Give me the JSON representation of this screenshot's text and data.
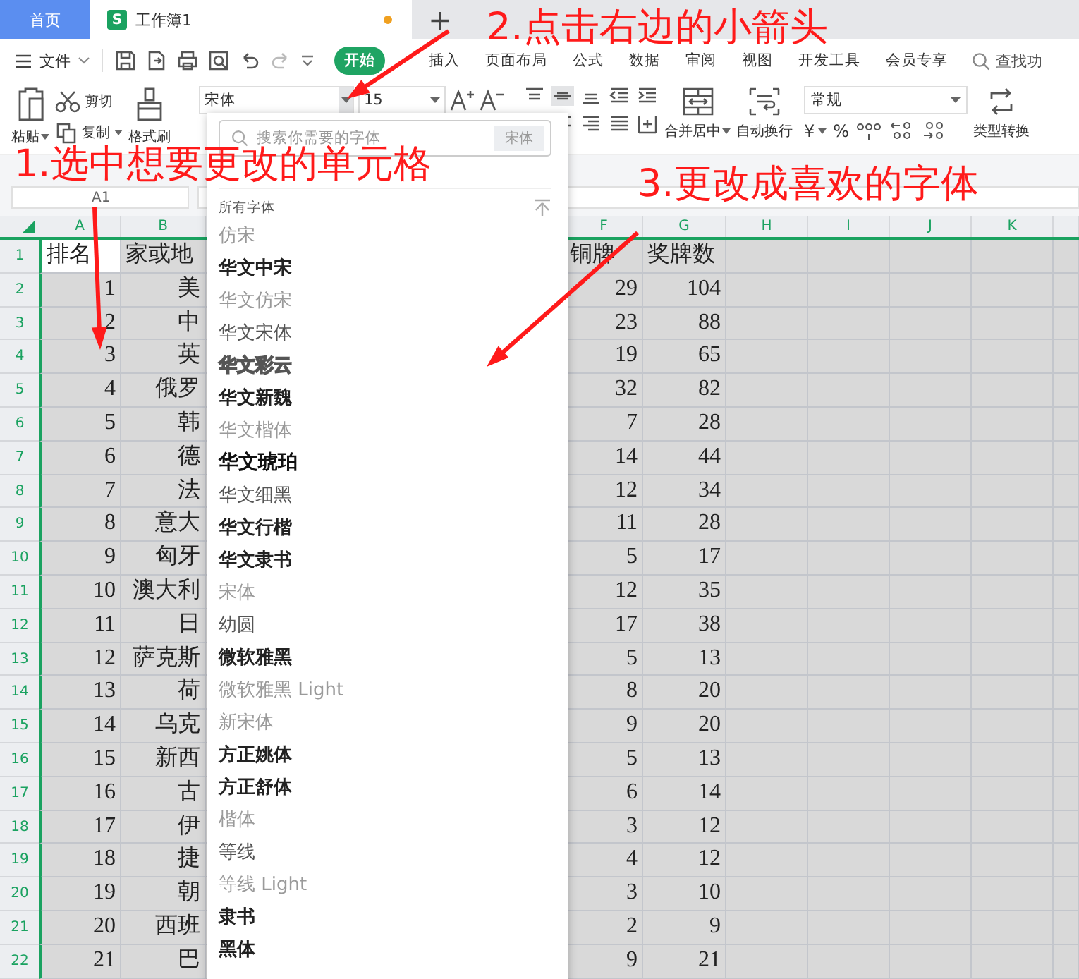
{
  "window_tabs": [
    {
      "kind": "home",
      "label": "首页",
      "selected": false
    },
    {
      "kind": "document",
      "label": "工作簿1",
      "badge": "S",
      "unsaved": true,
      "selected": true
    }
  ],
  "new_tab": "+",
  "menu": {
    "file": "文件",
    "tabs": [
      {
        "label": "开始",
        "selected": true
      },
      {
        "label": "插入",
        "selected": false
      },
      {
        "label": "页面布局",
        "selected": false
      },
      {
        "label": "公式",
        "selected": false
      },
      {
        "label": "数据",
        "selected": false
      },
      {
        "label": "审阅",
        "selected": false
      },
      {
        "label": "视图",
        "selected": false
      },
      {
        "label": "开发工具",
        "selected": false
      },
      {
        "label": "会员专享",
        "selected": false
      }
    ],
    "search": "查找功"
  },
  "ribbon": {
    "paste": "粘贴",
    "cut": "剪切",
    "copy": "复制",
    "format_painter": "格式刷",
    "font": "宋体",
    "size": "15",
    "merge": "合并居中",
    "wrap": "自动换行",
    "number_format": "常规",
    "currency": "¥",
    "percent": "%",
    "convert": "类型转换"
  },
  "name_box": "A1",
  "font_dropdown": {
    "search_placeholder": "搜索你需要的字体",
    "current": "宋体",
    "section": "所有字体",
    "fonts": [
      {
        "name": "仿宋",
        "kind": "light"
      },
      {
        "name": "华文中宋",
        "kind": "bold"
      },
      {
        "name": "华文仿宋",
        "kind": "light"
      },
      {
        "name": "华文宋体",
        "kind": "regular"
      },
      {
        "name": "华文彩云",
        "kind": "outline"
      },
      {
        "name": "华文新魏",
        "kind": "bold"
      },
      {
        "name": "华文楷体",
        "kind": "light"
      },
      {
        "name": "华文琥珀",
        "kind": "heavy"
      },
      {
        "name": "华文细黑",
        "kind": "regular"
      },
      {
        "name": "华文行楷",
        "kind": "bold"
      },
      {
        "name": "华文隶书",
        "kind": "bold"
      },
      {
        "name": "宋体",
        "kind": "light"
      },
      {
        "name": "幼圆",
        "kind": "regular"
      },
      {
        "name": "微软雅黑",
        "kind": "bold"
      },
      {
        "name": "微软雅黑 Light",
        "kind": "light"
      },
      {
        "name": "新宋体",
        "kind": "light"
      },
      {
        "name": "方正姚体",
        "kind": "bold"
      },
      {
        "name": "方正舒体",
        "kind": "bold"
      },
      {
        "name": "楷体",
        "kind": "light"
      },
      {
        "name": "等线",
        "kind": "regular"
      },
      {
        "name": "等线 Light",
        "kind": "light"
      },
      {
        "name": "隶书",
        "kind": "bold"
      },
      {
        "name": "黑体",
        "kind": "bold"
      }
    ]
  },
  "sheet": {
    "all_selected": true,
    "columns": [
      "A",
      "B",
      "F",
      "G",
      "H",
      "I",
      "J",
      "K"
    ],
    "rows": [
      {
        "number": "1",
        "active": true,
        "cells": [
          "排名",
          "家或地",
          "铜牌",
          "奖牌数"
        ]
      },
      {
        "number": "2",
        "active": false,
        "cells": [
          "1",
          "美",
          "29",
          "104"
        ]
      },
      {
        "number": "3",
        "active": false,
        "cells": [
          "2",
          "中",
          "23",
          "88"
        ]
      },
      {
        "number": "4",
        "active": false,
        "cells": [
          "3",
          "英",
          "19",
          "65"
        ]
      },
      {
        "number": "5",
        "active": false,
        "cells": [
          "4",
          "俄罗",
          "32",
          "82"
        ]
      },
      {
        "number": "6",
        "active": false,
        "cells": [
          "5",
          "韩",
          "7",
          "28"
        ]
      },
      {
        "number": "7",
        "active": false,
        "cells": [
          "6",
          "德",
          "14",
          "44"
        ]
      },
      {
        "number": "8",
        "active": false,
        "cells": [
          "7",
          "法",
          "12",
          "34"
        ]
      },
      {
        "number": "9",
        "active": false,
        "cells": [
          "8",
          "意大",
          "11",
          "28"
        ]
      },
      {
        "number": "10",
        "active": false,
        "cells": [
          "9",
          "匈牙",
          "5",
          "17"
        ]
      },
      {
        "number": "11",
        "active": false,
        "cells": [
          "10",
          "澳大利",
          "12",
          "35"
        ]
      },
      {
        "number": "12",
        "active": false,
        "cells": [
          "11",
          "日",
          "17",
          "38"
        ]
      },
      {
        "number": "13",
        "active": false,
        "cells": [
          "12",
          "萨克斯",
          "5",
          "13"
        ]
      },
      {
        "number": "14",
        "active": false,
        "cells": [
          "13",
          "荷",
          "8",
          "20"
        ]
      },
      {
        "number": "15",
        "active": false,
        "cells": [
          "14",
          "乌克",
          "9",
          "20"
        ]
      },
      {
        "number": "16",
        "active": false,
        "cells": [
          "15",
          "新西",
          "5",
          "13"
        ]
      },
      {
        "number": "17",
        "active": false,
        "cells": [
          "16",
          "古",
          "6",
          "14"
        ]
      },
      {
        "number": "18",
        "active": false,
        "cells": [
          "17",
          "伊",
          "3",
          "12"
        ]
      },
      {
        "number": "19",
        "active": false,
        "cells": [
          "18",
          "捷",
          "4",
          "12"
        ]
      },
      {
        "number": "20",
        "active": false,
        "cells": [
          "19",
          "朝",
          "3",
          "10"
        ]
      },
      {
        "number": "21",
        "active": false,
        "cells": [
          "20",
          "西班",
          "2",
          "9"
        ]
      },
      {
        "number": "22",
        "active": false,
        "cells": [
          "21",
          "巴",
          "9",
          "21"
        ]
      }
    ]
  },
  "annotations": [
    {
      "text": "2.点击右边的小箭头"
    },
    {
      "text": "1.选中想要更改的单元格"
    },
    {
      "text": "3.更改成喜欢的字体"
    }
  ]
}
